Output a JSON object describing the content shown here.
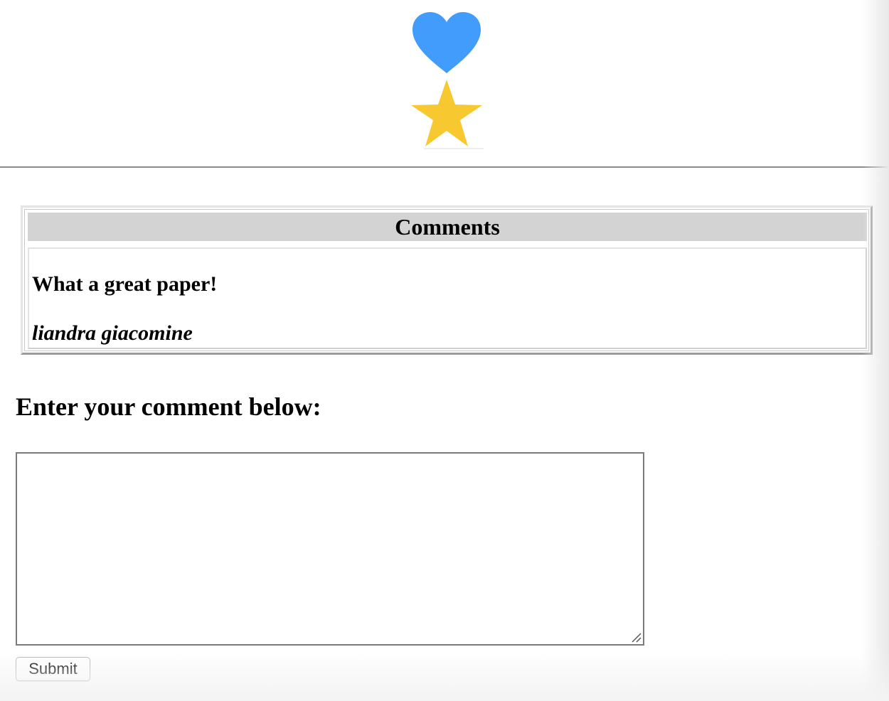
{
  "icons": {
    "heart": {
      "name": "heart-icon",
      "color": "#429cfc"
    },
    "star": {
      "name": "star-icon",
      "color": "#f8c831"
    }
  },
  "comments": {
    "header": "Comments",
    "items": [
      {
        "text": "What a great paper!",
        "author": "liandra giacomine"
      }
    ]
  },
  "form": {
    "heading": "Enter your comment below:",
    "textarea_value": "",
    "submit_label": "Submit"
  }
}
